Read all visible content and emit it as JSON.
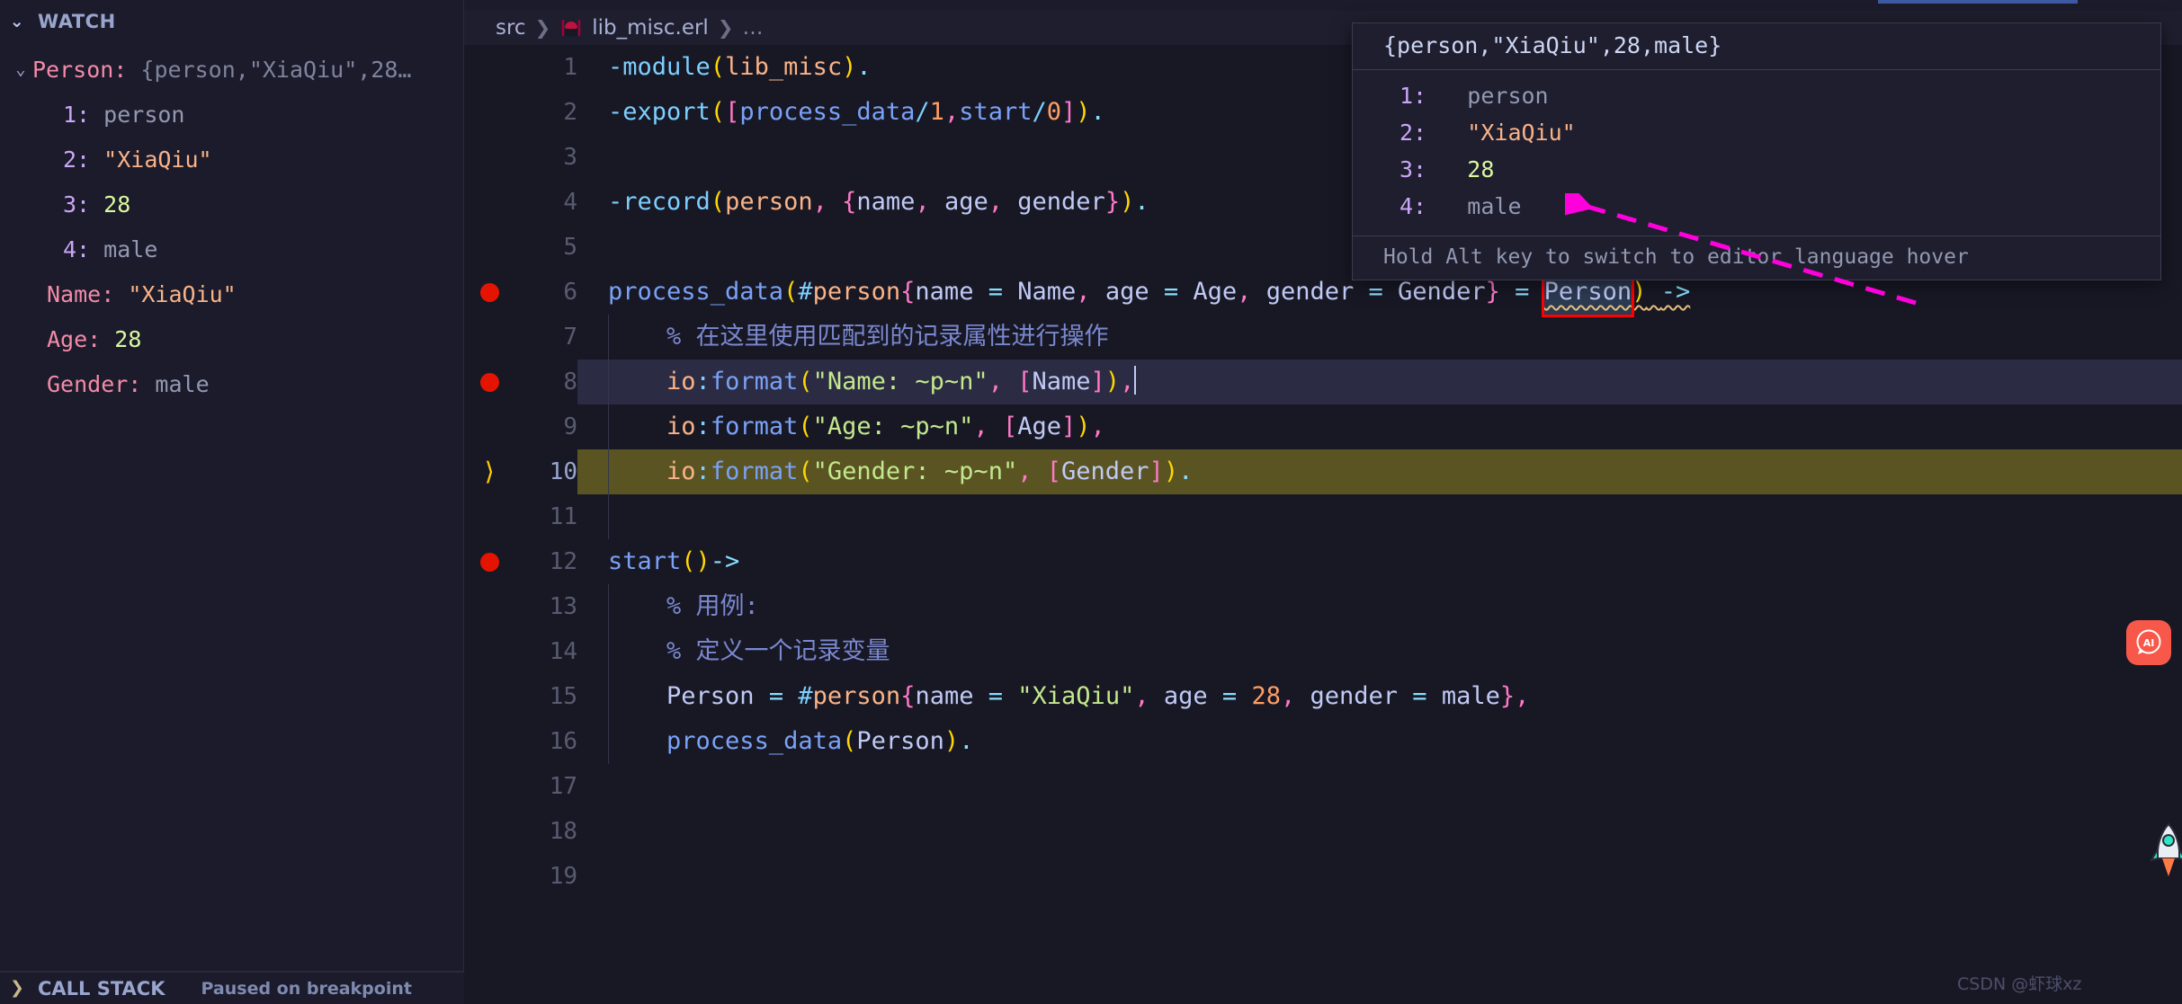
{
  "sidebar": {
    "watch_panel": {
      "title": "WATCH",
      "twisty": "expanded",
      "root": {
        "key": "Person:",
        "value": "{person,\"XiaQiu\",28…",
        "twisty": "expanded"
      },
      "children": [
        {
          "key": "1:",
          "value": "person",
          "value_kind": "atom-gray"
        },
        {
          "key": "2:",
          "value": "\"XiaQiu\"",
          "value_kind": "string"
        },
        {
          "key": "3:",
          "value": "28",
          "value_kind": "number"
        },
        {
          "key": "4:",
          "value": "male",
          "value_kind": "atom-gray"
        }
      ],
      "expressions": [
        {
          "key": "Name:",
          "value": "\"XiaQiu\"",
          "value_kind": "string"
        },
        {
          "key": "Age:",
          "value": "28",
          "value_kind": "number"
        },
        {
          "key": "Gender:",
          "value": "male",
          "value_kind": "atom-gray"
        }
      ]
    },
    "call_stack_panel": {
      "title": "CALL STACK",
      "twisty": "collapsed",
      "status": "Paused on breakpoint"
    }
  },
  "breadcrumb": {
    "items": [
      "src",
      "lib_misc.erl",
      "…"
    ],
    "separator": "❯",
    "file_icon": "erlang-file-icon"
  },
  "editor": {
    "lines": [
      {
        "n": "1",
        "breakpoint": false,
        "current": false
      },
      {
        "n": "2",
        "breakpoint": false,
        "current": false
      },
      {
        "n": "3",
        "breakpoint": false,
        "current": false
      },
      {
        "n": "4",
        "breakpoint": false,
        "current": false
      },
      {
        "n": "5",
        "breakpoint": false,
        "current": false
      },
      {
        "n": "6",
        "breakpoint": true,
        "current": false
      },
      {
        "n": "7",
        "breakpoint": false,
        "current": false
      },
      {
        "n": "8",
        "breakpoint": true,
        "current": false
      },
      {
        "n": "9",
        "breakpoint": false,
        "current": false
      },
      {
        "n": "10",
        "breakpoint": false,
        "current": true
      },
      {
        "n": "11",
        "breakpoint": false,
        "current": false
      },
      {
        "n": "12",
        "breakpoint": true,
        "current": false
      },
      {
        "n": "13",
        "breakpoint": false,
        "current": false
      },
      {
        "n": "14",
        "breakpoint": false,
        "current": false
      },
      {
        "n": "15",
        "breakpoint": false,
        "current": false
      },
      {
        "n": "16",
        "breakpoint": false,
        "current": false
      },
      {
        "n": "17",
        "breakpoint": false,
        "current": false
      },
      {
        "n": "18",
        "breakpoint": false,
        "current": false
      },
      {
        "n": "19",
        "breakpoint": false,
        "current": false
      }
    ],
    "source": [
      "-module(lib_misc).",
      "-export([process_data/1,start/0]).",
      "",
      "-record(person, {name, age, gender}).",
      "",
      "process_data(#person{name = Name, age = Age, gender = Gender} = Person) ->",
      "    % 在这里使用匹配到的记录属性进行操作",
      "    io:format(\"Name: ~p~n\", [Name]),",
      "    io:format(\"Age: ~p~n\", [Age]),",
      "    io:format(\"Gender: ~p~n\", [Gender]).",
      "",
      "start()->",
      "    % 用例:",
      "    % 定义一个记录变量",
      "    Person = #person{name = \"XiaQiu\", age = 28, gender = male},",
      "    process_data(Person).",
      "",
      "",
      ""
    ],
    "highlighted_variable": "Person",
    "current_execution_line": "10",
    "selection_line": "8"
  },
  "hover": {
    "title": "{person,\"XiaQiu\",28,male}",
    "rows": [
      {
        "key": "1:",
        "value": "person",
        "value_kind": "atom-gray"
      },
      {
        "key": "2:",
        "value": "\"XiaQiu\"",
        "value_kind": "string"
      },
      {
        "key": "3:",
        "value": "28",
        "value_kind": "number"
      },
      {
        "key": "4:",
        "value": "male",
        "value_kind": "atom-gray"
      }
    ],
    "footer": "Hold Alt key to switch to editor language hover"
  },
  "overlays": {
    "ai_badge_label": "AI",
    "watermark": "CSDN @虾球xz",
    "annotation_arrow_color": "#ff00dd",
    "annotation_box_color": "#ff0000"
  },
  "colors": {
    "background": "#181825",
    "sidebar_bg": "#1b1b2b",
    "breakpoint_red": "#e51400",
    "current_line_yellow": "#5a5423",
    "accent_blue": "#7aa2f7"
  }
}
